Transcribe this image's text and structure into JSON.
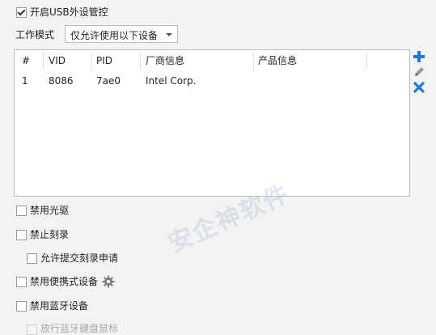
{
  "usb_control": {
    "label": "开启USB外设管控",
    "checked": true
  },
  "work_mode": {
    "label": "工作模式",
    "selected": "仅允许使用以下设备"
  },
  "device_table": {
    "columns": [
      "#",
      "VID",
      "PID",
      "厂商信息",
      "产品信息"
    ],
    "rows": [
      {
        "index": "1",
        "vid": "8086",
        "pid": "7ae0",
        "vendor": "Intel Corp.",
        "product": ""
      }
    ]
  },
  "side_actions": {
    "add_icon": "plus-icon",
    "edit_icon": "pencil-icon",
    "delete_icon": "x-icon"
  },
  "options": {
    "disable_cdrom": {
      "label": "禁用光驱",
      "checked": false
    },
    "disable_burn": {
      "label": "禁止刻录",
      "checked": false
    },
    "allow_burn_request": {
      "label": "允许提交刻录申请",
      "checked": false
    },
    "disable_portable": {
      "label": "禁用便携式设备",
      "checked": false
    },
    "disable_bluetooth": {
      "label": "禁用蓝牙设备",
      "checked": false
    },
    "allow_bt_keyboard": {
      "label": "放行蓝牙键盘鼠标",
      "checked": false,
      "disabled": true
    }
  },
  "watermark_text": "安企神软件"
}
